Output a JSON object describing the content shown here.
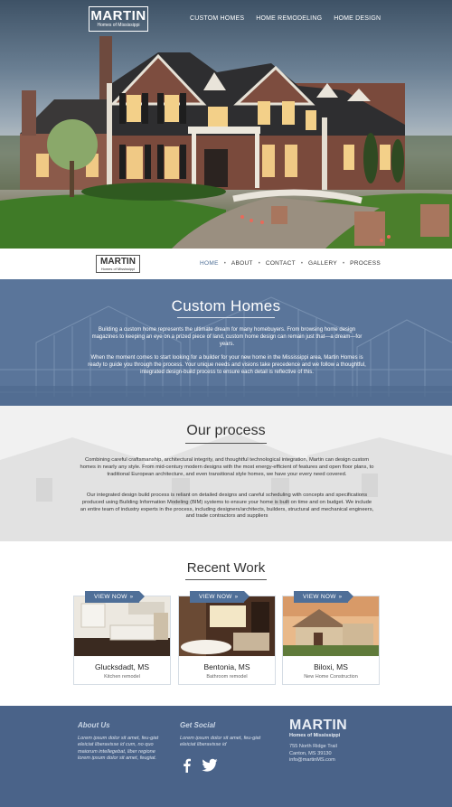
{
  "hero": {
    "logo_main": "MARTIN",
    "logo_sub": "Homes of Mississippi",
    "nav": [
      "CUSTOM HOMES",
      "HOME REMODELING",
      "HOME DESIGN"
    ]
  },
  "subnav": {
    "logo_main": "MARTIN",
    "logo_sub": "Homes of Mississippi",
    "items": [
      "HOME",
      "ABOUT",
      "CONTACT",
      "GALLERY",
      "PROCESS"
    ],
    "active": "HOME",
    "separator": "•"
  },
  "custom_homes": {
    "title": "Custom Homes",
    "p1": "Building a custom home represents the ultimate dream for many homebuyers. From browsing home design magazines to keeping an eye on a prized piece of land, custom home design can remain just that—a dream—for years.",
    "p2": "When the moment comes to start looking for a builder for your new home in the Mississippi area, Martin Homes is ready to guide you through the process. Your unique needs and visions take precedence and we follow a thoughtful, integrated design-build process to ensure each detail is reflective of this."
  },
  "process": {
    "title": "Our process",
    "p1": "Combining careful craftsmanship, architectural integrity, and thoughtful technological integration, Martin can design custom homes in nearly any style. From mid-century modern designs with the most energy-efficient of features and open floor plans, to traditional European architecture, and even transitional style homes, we have your every need covered.",
    "p2": "Our integrated design build process is reliant on detailed designs and careful scheduling with concepts and specifications produced using Building Information Modeling (BIM) systems to ensure your home is built on time and on budget. We include an entire team of industry experts in the process, including designers/architects, builders, structural and mechanical engineers, and trade contractors and suppliers"
  },
  "recent_work": {
    "title": "Recent Work",
    "view_label": "VIEW NOW",
    "chevron": "»",
    "cards": [
      {
        "city": "Glucksdadt, MS",
        "type": "Kitchen remodel"
      },
      {
        "city": "Bentonia, MS",
        "type": "Bathroom remodel"
      },
      {
        "city": "Biloxi, MS",
        "type": "New Home Construction"
      }
    ]
  },
  "footer": {
    "about_title": "About Us",
    "about_text": "Lorem ipsum dolor sit amet, feu-giat eleiciat liberavisse id cum, no quo maiorum intellegebat, liber regione lorem ipsum dolor sit amet, feugiat.",
    "social_title": "Get Social",
    "social_text": "Lorem ipsum dolor sit amet, feu-giat eleiciat liberavisse id",
    "logo_main": "MARTIN",
    "logo_sub": "Homes of Mississippi",
    "address1": "755 North Ridge Trail",
    "address2": "Canton, MS 39130",
    "email": "info@martinMS.com",
    "icons": [
      "facebook-icon",
      "twitter-icon"
    ]
  },
  "colors": {
    "brand_blue": "#4f6f98",
    "footer_bg": "#4a6389",
    "section_blue": "#5a759a"
  }
}
